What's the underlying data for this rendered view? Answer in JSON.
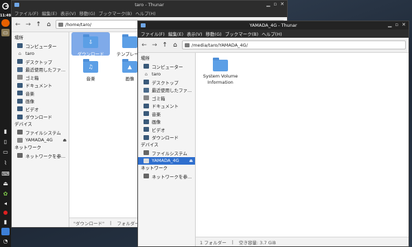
{
  "dock": {
    "clock": "11:49",
    "items": [
      "app-menu-icon",
      "firefox-icon",
      "terminal-icon",
      "file-manager-icon",
      "clipboard-icon",
      "display-icon",
      "link-icon",
      "keyboard-icon",
      "eject-icon",
      "android-icon",
      "sound-icon",
      "recorder-icon",
      "battery-icon",
      "files-icon",
      "network-icon"
    ]
  },
  "window_back": {
    "title": "taro - Thunar",
    "menu": [
      "ファイル(F)",
      "編集(E)",
      "表示(V)",
      "移動(G)",
      "ブックマーク(B)",
      "ヘルプ(H)"
    ],
    "address": "/home/taro/",
    "sidebar": {
      "places_heading": "場所",
      "places": [
        "コンピューター",
        "taro",
        "デスクトップ",
        "最近使用したファ...",
        "ゴミ箱",
        "ドキュメント",
        "音楽",
        "画像",
        "ビデオ",
        "ダウンロード"
      ],
      "devices_heading": "デバイス",
      "devices": [
        "ファイルシステム",
        "YAMADA_4G"
      ],
      "network_heading": "ネットワーク",
      "network": [
        "ネットワークを参..."
      ]
    },
    "folders": [
      "ダウンロード",
      "テンプレート",
      "音楽",
      "画像"
    ],
    "status": [
      "\"ダウンロード\"",
      "フォルダー"
    ]
  },
  "window_front": {
    "title": "YAMADA_4G - Thunar",
    "menu": [
      "ファイル(F)",
      "編集(E)",
      "表示(V)",
      "移動(G)",
      "ブックマーク(B)",
      "ヘルプ(H)"
    ],
    "address": "/media/taro/YAMADA_4G/",
    "sidebar": {
      "places_heading": "場所",
      "places": [
        "コンピューター",
        "taro",
        "デスクトップ",
        "最近使用したファ...",
        "ゴミ箱",
        "ドキュメント",
        "音楽",
        "画像",
        "ビデオ",
        "ダウンロード"
      ],
      "devices_heading": "デバイス",
      "devices": [
        "ファイルシステム",
        "YAMADA_4G"
      ],
      "network_heading": "ネットワーク",
      "network": [
        "ネットワークを参..."
      ]
    },
    "files": [
      {
        "name_line1": "System Volume",
        "name_line2": "Information"
      }
    ],
    "status": [
      "1 フォルダー",
      "空き容量: 3.7 GiB"
    ]
  },
  "colors": {
    "accent": "#2f6fce",
    "folder": "#5c9fe6",
    "titlebar": "#2d2d2d"
  }
}
